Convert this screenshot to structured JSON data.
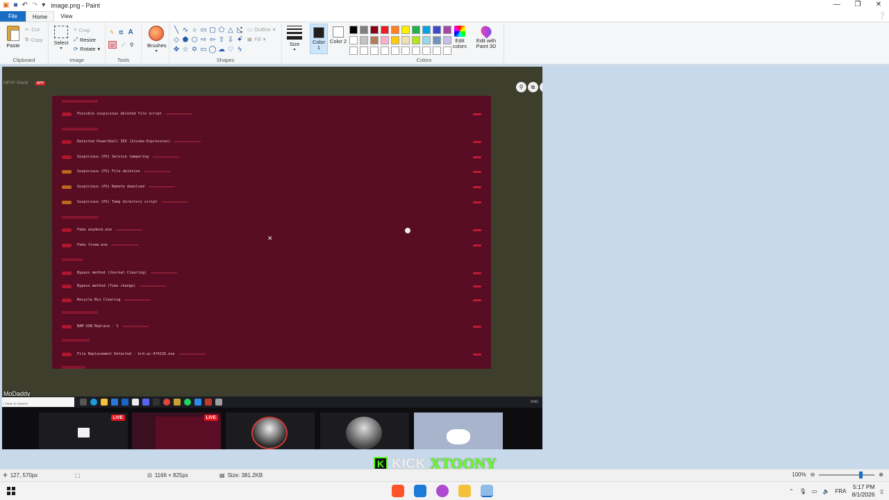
{
  "app": {
    "title": "image.png - Paint",
    "qa_icons": [
      "paint-app-icon",
      "save-icon",
      "undo-icon",
      "redo-icon",
      "customize-icon"
    ],
    "window_buttons": [
      "—",
      "❐",
      "✕"
    ]
  },
  "tabs": [
    "File",
    "Home",
    "View"
  ],
  "active_tab": "Home",
  "ribbon": {
    "clipboard": {
      "paste": "Paste",
      "cut": "Cut",
      "copy": "Copy",
      "label": "Clipboard"
    },
    "image": {
      "select": "Select",
      "crop": "Crop",
      "resize": "Resize",
      "rotate": "Rotate",
      "label": "Image"
    },
    "tools": {
      "label": "Tools"
    },
    "brushes": {
      "label": "Brushes"
    },
    "shapes": {
      "outline": "Outline",
      "fill": "Fill",
      "label": "Shapes"
    },
    "size": {
      "label": "Size"
    },
    "color1": {
      "label": "Color 1",
      "value": "#1f1f1f"
    },
    "color2": {
      "label": "Color 2",
      "value": "#ffffff"
    },
    "colors": {
      "label": "Colors"
    },
    "edit_colors": "Edit colors",
    "edit_with_paint3d": "Edit with Paint 3D",
    "palette": [
      "#000000",
      "#7f7f7f",
      "#880015",
      "#ed1c24",
      "#ff7f27",
      "#fff200",
      "#22b14c",
      "#00a2e8",
      "#3f48cc",
      "#a349a4",
      "#ffffff",
      "#c3c3c3",
      "#b97a57",
      "#ffaec9",
      "#ffc90e",
      "#efe4b0",
      "#b5e61d",
      "#99d9ea",
      "#7092be",
      "#c8bfe7",
      "#ffffff",
      "#ffffff",
      "#ffffff",
      "#ffffff",
      "#ffffff",
      "#ffffff",
      "#ffffff",
      "#ffffff",
      "#ffffff",
      "#ffffff"
    ]
  },
  "canvas": {
    "shield_tag": "MPVP Shield",
    "app_tag": "APP",
    "rows": [
      {
        "label": "Possible suspicious deleted file script",
        "badge": "red"
      },
      {
        "label": "Detected PowerShell IEX (Invoke-Expression)",
        "badge": "red"
      },
      {
        "label": "Suspicious (PS) Service tampering",
        "badge": "red"
      },
      {
        "label": "Suspicious (PS) File deletion",
        "badge": "amber"
      },
      {
        "label": "Suspicious (PS) Remote download",
        "badge": "amber"
      },
      {
        "label": "Suspicious (PS) Temp directory script",
        "badge": "amber"
      },
      {
        "label": "Fake anydesk.exe",
        "badge": "red"
      },
      {
        "label": "Fake fivem.exe",
        "badge": "red"
      },
      {
        "label": "Bypass method (Journal Clearing)",
        "badge": "red"
      },
      {
        "label": "Bypass method (Time change)",
        "badge": "red"
      },
      {
        "label": "Recycle Bin Clearing",
        "badge": "red"
      },
      {
        "label": "BAM USN Replace - 1",
        "badge": "red"
      },
      {
        "label": "File Replacement Detected - krd.ac-474226.exe",
        "badge": "red"
      }
    ],
    "streamer_name": "MoDaddy",
    "search_placeholder": "r here to search",
    "tray_lang": "ENG",
    "live_badge": "LIVE"
  },
  "kick": {
    "brand": "KICK",
    "channel": "XTOONY",
    "logo_letter": "K"
  },
  "status": {
    "cursor_pos": "127, 570px",
    "canvas_size": "1166 × 825px",
    "file_size": "Size: 381.2KB",
    "zoom": "100%"
  },
  "taskbar": {
    "lang": "FRA",
    "time": "5:17 PM",
    "date": "8/1/2026"
  }
}
